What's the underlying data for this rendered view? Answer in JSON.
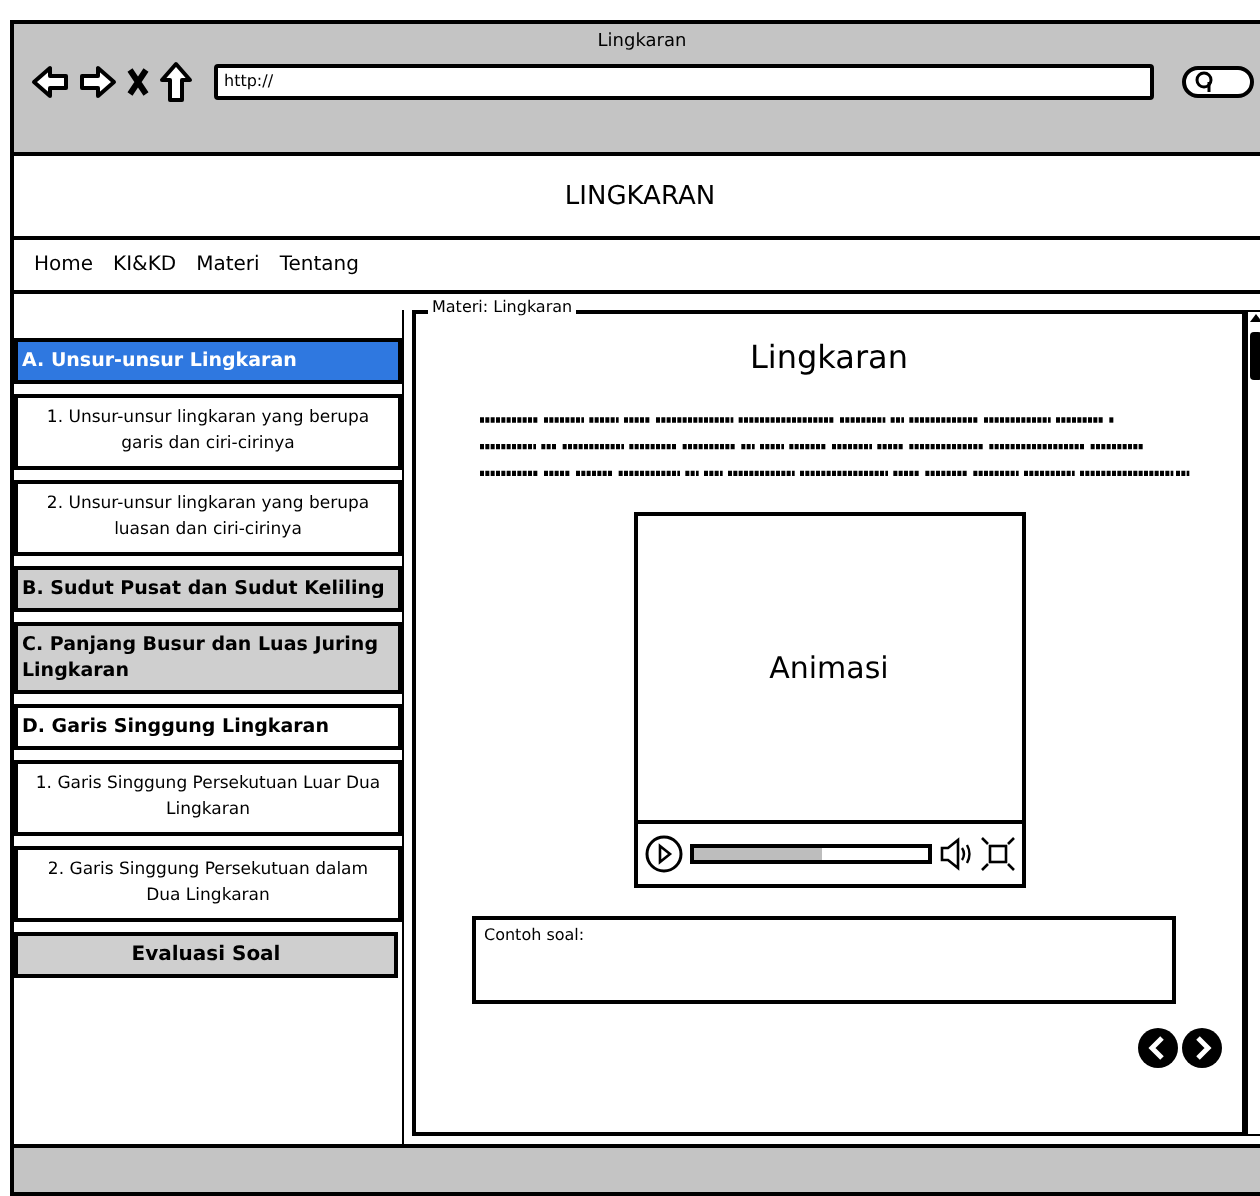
{
  "window": {
    "title": "Lingkaran"
  },
  "address_bar": {
    "value": "http://"
  },
  "header": {
    "title": "LINGKARAN"
  },
  "nav": [
    {
      "label": "Home"
    },
    {
      "label": "KI&KD"
    },
    {
      "label": "Materi"
    },
    {
      "label": "Tentang"
    }
  ],
  "sidebar": {
    "items": [
      {
        "kind": "section",
        "label": "A. Unsur-unsur Lingkaran",
        "selected": true,
        "expanded": true,
        "children": [
          {
            "label": "1. Unsur-unsur lingkaran yang berupa garis dan ciri-cirinya"
          },
          {
            "label": "2. Unsur-unsur lingkaran yang berupa luasan dan ciri-cirinya"
          }
        ]
      },
      {
        "kind": "section",
        "label": "B. Sudut Pusat dan Sudut Keliling",
        "selected": false,
        "expanded": false
      },
      {
        "kind": "section",
        "label": "C. Panjang Busur dan Luas Juring Lingkaran",
        "selected": false,
        "expanded": false
      },
      {
        "kind": "section",
        "label": "D. Garis Singgung Lingkaran",
        "selected": false,
        "expanded": true,
        "children": [
          {
            "label": "1. Garis Singgung Persekutuan Luar Dua Lingkaran"
          },
          {
            "label": "2. Garis Singgung Persekutuan dalam Dua Lingkaran"
          }
        ]
      },
      {
        "kind": "button",
        "label": "Evaluasi Soal"
      }
    ]
  },
  "content": {
    "legend": "Materi: Lingkaran",
    "title": "Lingkaran",
    "video": {
      "label": "Animasi",
      "level": 0.55
    },
    "example": {
      "label": "Contoh soal:"
    }
  }
}
